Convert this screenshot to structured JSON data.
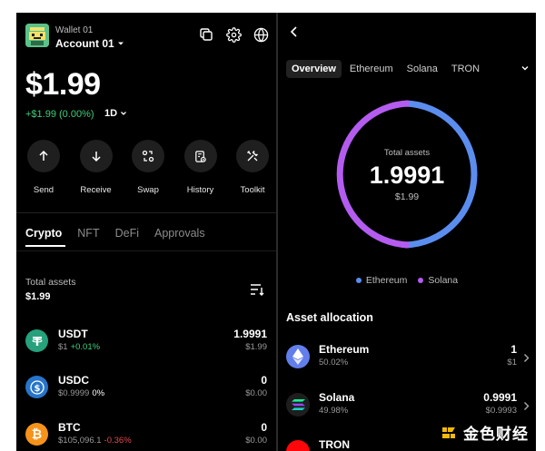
{
  "header": {
    "wallet_name": "Wallet 01",
    "account": "Account 01",
    "icons": [
      "copy-icon",
      "settings-gear-icon",
      "globe-icon"
    ]
  },
  "balance": {
    "total": "$1.99",
    "change": "+$1.99 (0.00%)",
    "range": "1D"
  },
  "actions": [
    {
      "label": "Send",
      "icon": "arrow-up-icon"
    },
    {
      "label": "Receive",
      "icon": "arrow-down-icon"
    },
    {
      "label": "Swap",
      "icon": "swap-icon"
    },
    {
      "label": "History",
      "icon": "history-icon"
    },
    {
      "label": "Toolkit",
      "icon": "toolkit-icon"
    }
  ],
  "tabs": [
    "Crypto",
    "NFT",
    "DeFi",
    "Approvals"
  ],
  "total_assets": {
    "label": "Total assets",
    "value": "$1.99"
  },
  "assets": [
    {
      "symbol": "USDT",
      "price": "$1",
      "pct": "+0.01%",
      "amount": "1.9991",
      "usd": "$1.99",
      "color": "#26a17b",
      "glyph": "T"
    },
    {
      "symbol": "USDC",
      "price": "$0.9999",
      "pct": "0%",
      "amount": "0",
      "usd": "$0.00",
      "color": "#2775ca",
      "glyph": "$"
    },
    {
      "symbol": "BTC",
      "price": "$105,096.1",
      "pct": "-0.36%",
      "amount": "0",
      "usd": "$0.00",
      "color": "#f7931a",
      "glyph": "₿"
    }
  ],
  "right": {
    "tabs": [
      "Overview",
      "Ethereum",
      "Solana",
      "TRON"
    ],
    "donut": {
      "label": "Total assets",
      "value": "1.9991",
      "usd": "$1.99"
    },
    "legend": [
      {
        "name": "Ethereum",
        "color": "#5b8def"
      },
      {
        "name": "Solana",
        "color": "#b45cf0"
      }
    ],
    "allocation_title": "Asset allocation",
    "allocation": [
      {
        "name": "Ethereum",
        "share": "50.02%",
        "amount": "1",
        "usd": "$1"
      },
      {
        "name": "Solana",
        "share": "49.98%",
        "amount": "0.9991",
        "usd": "$0.9993"
      },
      {
        "name": "TRON",
        "share": "",
        "amount": "",
        "usd": ""
      }
    ]
  },
  "chart_data": {
    "type": "pie",
    "categories": [
      "Ethereum",
      "Solana"
    ],
    "values": [
      50.02,
      49.98
    ],
    "colors": [
      "#5b8def",
      "#b45cf0"
    ]
  },
  "watermark": {
    "text": "金色财经"
  }
}
